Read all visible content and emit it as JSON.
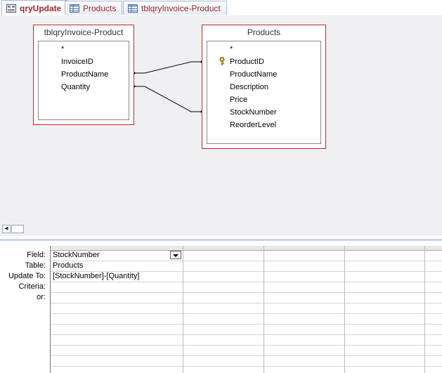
{
  "tabs": [
    {
      "label": "qryUpdate",
      "icon": "query-icon",
      "active": true
    },
    {
      "label": "Products",
      "icon": "table-icon",
      "active": false
    },
    {
      "label": "tblqryInvoice-Product",
      "icon": "table-icon",
      "active": false
    }
  ],
  "tables": [
    {
      "title": "tblqryInvoice-Product",
      "fields": [
        "*",
        "InvoiceID",
        "ProductName",
        "Quantity"
      ]
    },
    {
      "title": "Products",
      "fields": [
        "*",
        "ProductID",
        "ProductName",
        "Description",
        "Price",
        "StockNumber",
        "ReorderLevel"
      ],
      "primary_key": "ProductID"
    }
  ],
  "grid": {
    "row_labels": [
      "Field:",
      "Table:",
      "Update To:",
      "Criteria:",
      "or:"
    ],
    "columns": [
      {
        "field": "StockNumber",
        "table": "Products",
        "update_to": "[StockNumber]-[Quantity]",
        "criteria": "",
        "or": ""
      },
      {
        "field": "",
        "table": "",
        "update_to": "",
        "criteria": "",
        "or": ""
      },
      {
        "field": "",
        "table": "",
        "update_to": "",
        "criteria": "",
        "or": ""
      },
      {
        "field": "",
        "table": "",
        "update_to": "",
        "criteria": "",
        "or": ""
      },
      {
        "field": "",
        "table": "",
        "update_to": "",
        "criteria": "",
        "or": ""
      }
    ]
  },
  "colors": {
    "accent": "#a1262b",
    "table_border": "#a8362f",
    "designer_bg": "#f0f0f3"
  }
}
